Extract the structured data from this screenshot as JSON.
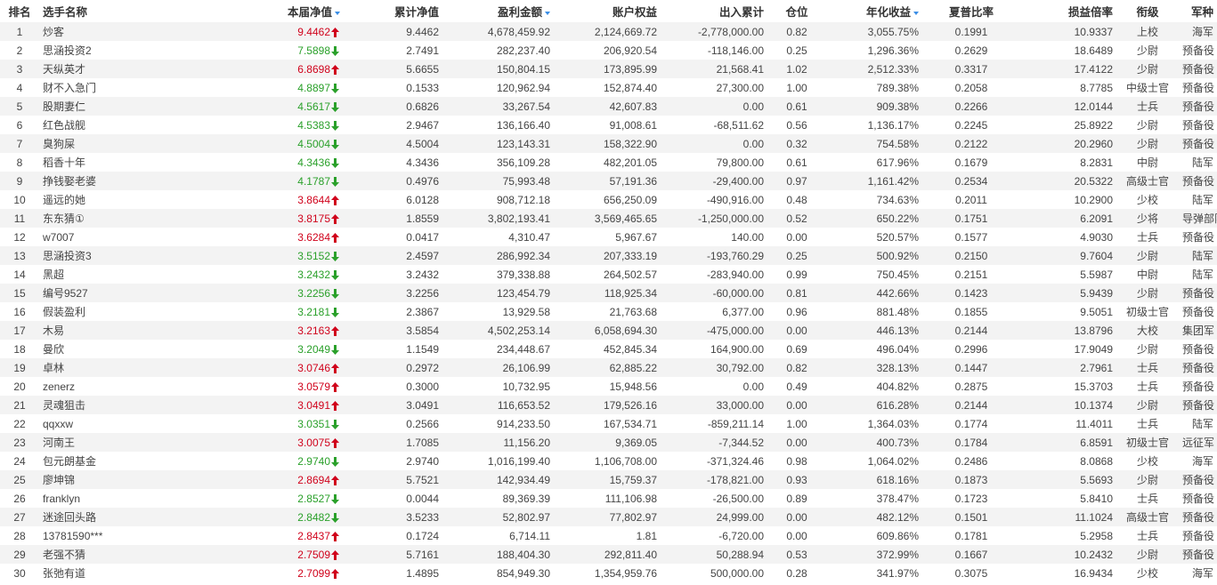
{
  "headers": [
    "排名",
    "选手名称",
    "本届净值",
    "累计净值",
    "盈利金额",
    "账户权益",
    "出入累计",
    "仓位",
    "年化收益",
    "夏普比率",
    "损益倍率",
    "衔级",
    "军种"
  ],
  "sortable": [
    false,
    false,
    true,
    false,
    true,
    false,
    false,
    false,
    true,
    false,
    false,
    false,
    false
  ],
  "colors": {
    "up": "#d0021b",
    "down": "#2aa02a",
    "sort": "#3a8ee6",
    "stripe": "#f3f3f3"
  },
  "rows": [
    [
      "1",
      "炒客",
      "9.4462",
      "up",
      "9.4462",
      "4,678,459.92",
      "2,124,669.72",
      "-2,778,000.00",
      "0.82",
      "3,055.75%",
      "0.1991",
      "10.9337",
      "上校",
      "海军"
    ],
    [
      "2",
      "思涵投资2",
      "7.5898",
      "down",
      "2.7491",
      "282,237.40",
      "206,920.54",
      "-118,146.00",
      "0.25",
      "1,296.36%",
      "0.2629",
      "18.6489",
      "少尉",
      "预备役"
    ],
    [
      "3",
      "天纵英才",
      "6.8698",
      "up",
      "5.6655",
      "150,804.15",
      "173,895.99",
      "21,568.41",
      "1.02",
      "2,512.33%",
      "0.3317",
      "17.4122",
      "少尉",
      "预备役"
    ],
    [
      "4",
      "财不入急门",
      "4.8897",
      "down",
      "0.1533",
      "120,962.94",
      "152,874.40",
      "27,300.00",
      "1.00",
      "789.38%",
      "0.2058",
      "8.7785",
      "中级士官",
      "预备役"
    ],
    [
      "5",
      "股期妻仁",
      "4.5617",
      "down",
      "0.6826",
      "33,267.54",
      "42,607.83",
      "0.00",
      "0.61",
      "909.38%",
      "0.2266",
      "12.0144",
      "士兵",
      "预备役"
    ],
    [
      "6",
      "红色战舰",
      "4.5383",
      "down",
      "2.9467",
      "136,166.40",
      "91,008.61",
      "-68,511.62",
      "0.56",
      "1,136.17%",
      "0.2245",
      "25.8922",
      "少尉",
      "预备役"
    ],
    [
      "7",
      "臭狗屎",
      "4.5004",
      "down",
      "4.5004",
      "123,143.31",
      "158,322.90",
      "0.00",
      "0.32",
      "754.58%",
      "0.2122",
      "20.2960",
      "少尉",
      "预备役"
    ],
    [
      "8",
      "稻香十年",
      "4.3436",
      "down",
      "4.3436",
      "356,109.28",
      "482,201.05",
      "79,800.00",
      "0.61",
      "617.96%",
      "0.1679",
      "8.2831",
      "中尉",
      "陆军"
    ],
    [
      "9",
      "挣钱娶老婆",
      "4.1787",
      "down",
      "0.4976",
      "75,993.48",
      "57,191.36",
      "-29,400.00",
      "0.97",
      "1,161.42%",
      "0.2534",
      "20.5322",
      "高级士官",
      "预备役"
    ],
    [
      "10",
      "遥远的她",
      "3.8644",
      "up",
      "6.0128",
      "908,712.18",
      "656,250.09",
      "-490,916.00",
      "0.48",
      "734.63%",
      "0.2011",
      "10.2900",
      "少校",
      "陆军"
    ],
    [
      "11",
      "东东猜①",
      "3.8175",
      "up",
      "1.8559",
      "3,802,193.41",
      "3,569,465.65",
      "-1,250,000.00",
      "0.52",
      "650.22%",
      "0.1751",
      "6.2091",
      "少将",
      "导弹部队"
    ],
    [
      "12",
      "w7007",
      "3.6284",
      "up",
      "0.0417",
      "4,310.47",
      "5,967.67",
      "140.00",
      "0.00",
      "520.57%",
      "0.1577",
      "4.9030",
      "士兵",
      "预备役"
    ],
    [
      "13",
      "思涵投资3",
      "3.5152",
      "down",
      "2.4597",
      "286,992.34",
      "207,333.19",
      "-193,760.29",
      "0.25",
      "500.92%",
      "0.2150",
      "9.7604",
      "少尉",
      "陆军"
    ],
    [
      "14",
      "黑超",
      "3.2432",
      "down",
      "3.2432",
      "379,338.88",
      "264,502.57",
      "-283,940.00",
      "0.99",
      "750.45%",
      "0.2151",
      "5.5987",
      "中尉",
      "陆军"
    ],
    [
      "15",
      "编号9527",
      "3.2256",
      "down",
      "3.2256",
      "123,454.79",
      "118,925.34",
      "-60,000.00",
      "0.81",
      "442.66%",
      "0.1423",
      "5.9439",
      "少尉",
      "预备役"
    ],
    [
      "16",
      "假装盈利",
      "3.2181",
      "down",
      "2.3867",
      "13,929.58",
      "21,763.68",
      "6,377.00",
      "0.96",
      "881.48%",
      "0.1855",
      "9.5051",
      "初级士官",
      "预备役"
    ],
    [
      "17",
      "木易",
      "3.2163",
      "up",
      "3.5854",
      "4,502,253.14",
      "6,058,694.30",
      "-475,000.00",
      "0.00",
      "446.13%",
      "0.2144",
      "13.8796",
      "大校",
      "集团军"
    ],
    [
      "18",
      "曼欣",
      "3.2049",
      "down",
      "1.1549",
      "234,448.67",
      "452,845.34",
      "164,900.00",
      "0.69",
      "496.04%",
      "0.2996",
      "17.9049",
      "少尉",
      "预备役"
    ],
    [
      "19",
      "卓林",
      "3.0746",
      "up",
      "0.2972",
      "26,106.99",
      "62,885.22",
      "30,792.00",
      "0.82",
      "328.13%",
      "0.1447",
      "2.7961",
      "士兵",
      "预备役"
    ],
    [
      "20",
      "zenerz",
      "3.0579",
      "up",
      "0.3000",
      "10,732.95",
      "15,948.56",
      "0.00",
      "0.49",
      "404.82%",
      "0.2875",
      "15.3703",
      "士兵",
      "预备役"
    ],
    [
      "21",
      "灵魂狙击",
      "3.0491",
      "up",
      "3.0491",
      "116,653.52",
      "179,526.16",
      "33,000.00",
      "0.00",
      "616.28%",
      "0.2144",
      "10.1374",
      "少尉",
      "预备役"
    ],
    [
      "22",
      "qqxxw",
      "3.0351",
      "down",
      "0.2566",
      "914,233.50",
      "167,534.71",
      "-859,211.14",
      "1.00",
      "1,364.03%",
      "0.1774",
      "11.4011",
      "士兵",
      "陆军"
    ],
    [
      "23",
      "河南王",
      "3.0075",
      "up",
      "1.7085",
      "11,156.20",
      "9,369.05",
      "-7,344.52",
      "0.00",
      "400.73%",
      "0.1784",
      "6.8591",
      "初级士官",
      "远征军"
    ],
    [
      "24",
      "包元朗基金",
      "2.9740",
      "down",
      "2.9740",
      "1,016,199.40",
      "1,106,708.00",
      "-371,324.46",
      "0.98",
      "1,064.02%",
      "0.2486",
      "8.0868",
      "少校",
      "海军"
    ],
    [
      "25",
      "廖坤锦",
      "2.8694",
      "up",
      "5.7521",
      "142,934.49",
      "15,759.37",
      "-178,821.00",
      "0.93",
      "618.16%",
      "0.1873",
      "5.5693",
      "少尉",
      "预备役"
    ],
    [
      "26",
      "franklyn",
      "2.8527",
      "down",
      "0.0044",
      "89,369.39",
      "111,106.98",
      "-26,500.00",
      "0.89",
      "378.47%",
      "0.1723",
      "5.8410",
      "士兵",
      "预备役"
    ],
    [
      "27",
      "迷途回头路",
      "2.8482",
      "down",
      "3.5233",
      "52,802.97",
      "77,802.97",
      "24,999.00",
      "0.00",
      "482.12%",
      "0.1501",
      "11.1024",
      "高级士官",
      "预备役"
    ],
    [
      "28",
      "13781590***",
      "2.8437",
      "up",
      "0.1724",
      "6,714.11",
      "1.81",
      "-6,720.00",
      "0.00",
      "609.86%",
      "0.1781",
      "5.2958",
      "士兵",
      "预备役"
    ],
    [
      "29",
      "老强不猜",
      "2.7509",
      "up",
      "5.7161",
      "188,404.30",
      "292,811.40",
      "50,288.94",
      "0.53",
      "372.99%",
      "0.1667",
      "10.2432",
      "少尉",
      "预备役"
    ],
    [
      "30",
      "张弛有道",
      "2.7099",
      "up",
      "1.4895",
      "854,949.30",
      "1,354,959.76",
      "500,000.00",
      "0.28",
      "341.97%",
      "0.3075",
      "16.9434",
      "少校",
      "海军"
    ]
  ]
}
